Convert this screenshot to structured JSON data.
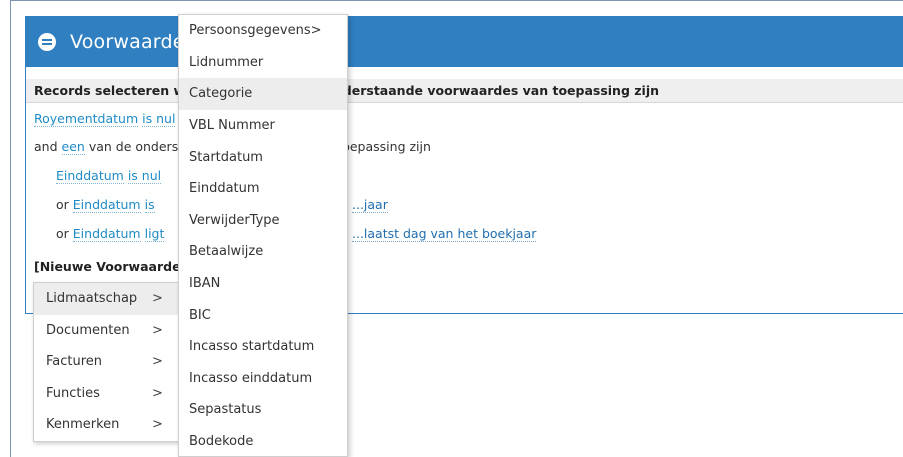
{
  "panel": {
    "title": "Voorwaarden",
    "rule_header": "Records selecteren waarvoor alle van de onderstaande voorwaardes van toepassing zijn"
  },
  "conditions": {
    "line1": {
      "field": "Royementdatum",
      "op": "is nul"
    },
    "line2": {
      "prefix": "and",
      "quant": "een",
      "text": "van de onderstaande voorwaardes van toepassing zijn"
    },
    "line3": {
      "field": "Einddatum",
      "op": "is nul"
    },
    "line4": {
      "prefix": "or",
      "field": "Einddatum",
      "op": "is",
      "value": "...jaar"
    },
    "line5": {
      "prefix": "or",
      "field": "Einddatum",
      "op": "ligt",
      "value": "...laatst dag van het boekjaar"
    },
    "new_condition": "[Nieuwe Voorwaarde t"
  },
  "submenu": {
    "items": [
      {
        "label": "Lidmaatschap",
        "arrow": ">",
        "active": true
      },
      {
        "label": "Documenten",
        "arrow": ">",
        "active": false
      },
      {
        "label": "Facturen",
        "arrow": ">",
        "active": false
      },
      {
        "label": "Functies",
        "arrow": ">",
        "active": false
      },
      {
        "label": "Kenmerken",
        "arrow": ">",
        "active": false
      }
    ]
  },
  "dropdown": {
    "items": [
      "Persoonsgegevens>",
      "Lidnummer",
      "Categorie",
      "VBL Nummer",
      "Startdatum",
      "Einddatum",
      "VerwijderType",
      "Betaalwijze",
      "IBAN",
      "BIC",
      "Incasso startdatum",
      "Incasso einddatum",
      "Sepastatus",
      "Bodekode"
    ],
    "active_index": 2
  }
}
